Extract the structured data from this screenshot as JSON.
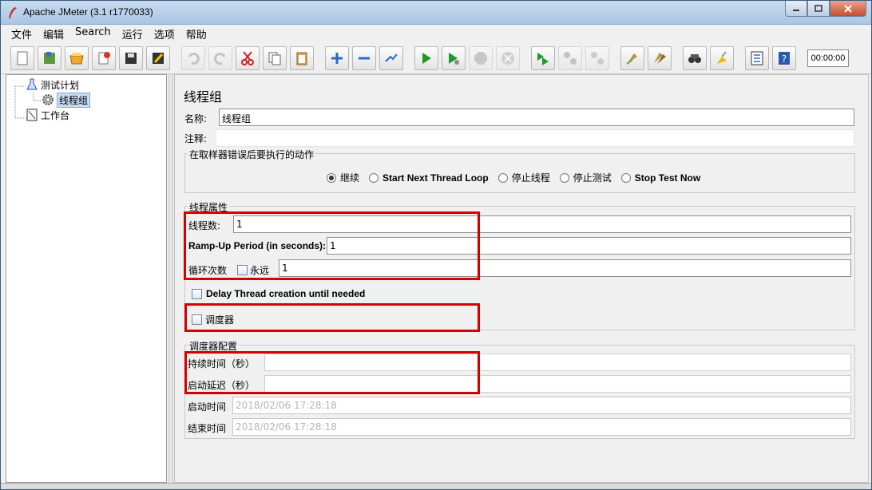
{
  "window": {
    "title": "Apache JMeter (3.1 r1770033)",
    "controls": {
      "minimize": "minimize-icon",
      "maximize": "maximize-icon",
      "close": "close-icon"
    }
  },
  "menu": [
    "文件",
    "编辑",
    "Search",
    "运行",
    "选项",
    "帮助"
  ],
  "toolbar": {
    "icons": [
      "new-icon",
      "templates-icon",
      "open-icon",
      "close-icon",
      "save-icon",
      "save-screenshot-icon",
      "undo-icon",
      "redo-icon",
      "cut-icon",
      "copy-icon",
      "paste-icon",
      "expand-icon",
      "collapse-icon",
      "toggle-icon",
      "start-icon",
      "start-no-pause-icon",
      "stop-icon",
      "shutdown-icon",
      "remote-start-icon",
      "remote-stop-icon",
      "remote-shutdown-icon",
      "clear-icon",
      "clear-all-icon",
      "search-icon",
      "reset-search-icon",
      "function-helper-icon",
      "help-icon"
    ],
    "timer": "00:00:00"
  },
  "tree": {
    "items": [
      {
        "label": "测试计划",
        "icon": "test-plan-icon"
      },
      {
        "label": "线程组",
        "icon": "gear-icon",
        "selected": true
      },
      {
        "label": "工作台",
        "icon": "workbench-icon"
      }
    ]
  },
  "panel": {
    "title": "线程组",
    "name_label": "名称:",
    "name_value": "线程组",
    "comment_label": "注释:",
    "comment_value": "",
    "on_error": {
      "title": "在取样器错误后要执行的动作",
      "options": [
        "继续",
        "Start Next Thread Loop",
        "停止线程",
        "停止测试",
        "Stop Test Now"
      ],
      "selected": "继续"
    },
    "thread_props": {
      "title": "线程属性",
      "threads_label": "线程数:",
      "threads_value": "1",
      "rampup_label": "Ramp-Up Period (in seconds):",
      "rampup_value": "1",
      "loop_label": "循环次数",
      "forever_label": "永远",
      "loop_value": "1",
      "delay_label": "Delay Thread creation until needed",
      "scheduler_label": "调度器"
    },
    "scheduler_config": {
      "title": "调度器配置",
      "duration_label": "持续时间（秒）",
      "duration_value": "",
      "delay_label": "启动延迟（秒）",
      "delay_value": "",
      "start_label": "启动时间",
      "start_value": "2018/02/06 17:28:18",
      "end_label": "结束时间",
      "end_value": "2018/02/06 17:28:18"
    }
  }
}
